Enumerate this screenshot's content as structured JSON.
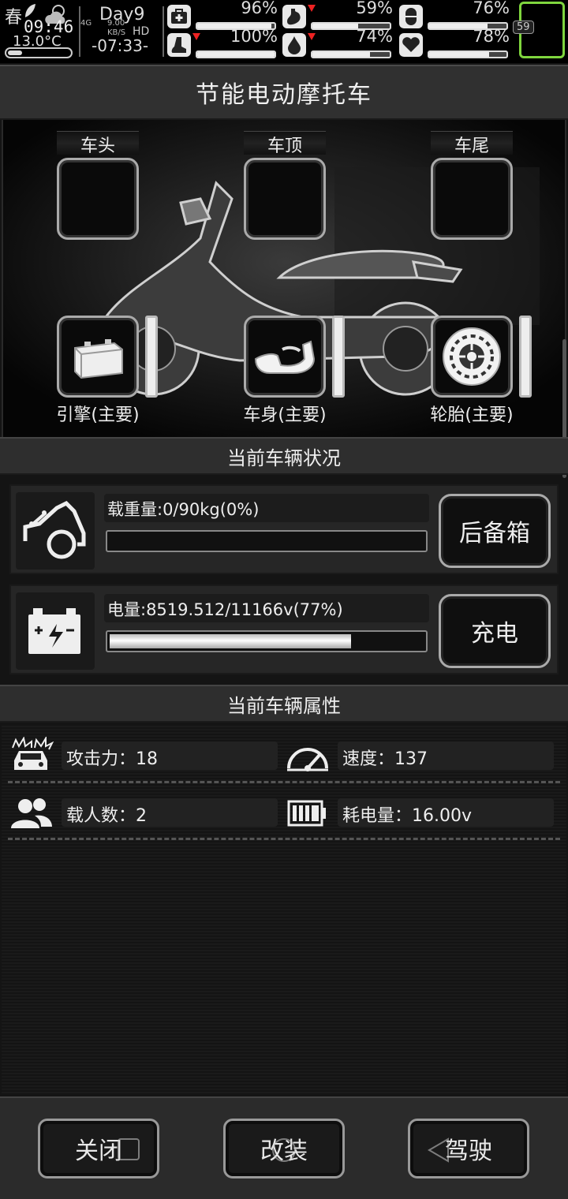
{
  "status_bar": {
    "season": "春",
    "time": "09:46",
    "temperature": "13.0°C",
    "day": "Day9",
    "network": "4G",
    "net_speed_value": "9.00",
    "net_speed_unit": "KB/S",
    "hd": "HD",
    "clock": "-07:33-",
    "stats": [
      {
        "icon": "medkit-icon",
        "value": "96%",
        "level": 0.96,
        "down": false
      },
      {
        "icon": "stomach-icon",
        "value": "59%",
        "level": 0.59,
        "down": true
      },
      {
        "icon": "capsule-icon",
        "value": "76%",
        "level": 0.76,
        "down": false
      },
      {
        "icon": "foot-icon",
        "value": "100%",
        "level": 1.0,
        "down": true
      },
      {
        "icon": "water-drop-icon",
        "value": "74%",
        "level": 0.74,
        "down": true
      },
      {
        "icon": "heart-icon",
        "value": "78%",
        "level": 0.78,
        "down": false
      }
    ],
    "battery_number": "59",
    "battery_color": "#7fd63e"
  },
  "title": "节能电动摩托车",
  "slots_top": [
    {
      "label": "车头"
    },
    {
      "label": "车顶"
    },
    {
      "label": "车尾"
    }
  ],
  "parts": [
    {
      "label": "引擎(主要)",
      "icon": "battery-engine-icon"
    },
    {
      "label": "车身(主要)",
      "icon": "scooter-body-icon"
    },
    {
      "label": "轮胎(主要)",
      "icon": "tire-icon"
    }
  ],
  "condition": {
    "header": "当前车辆状况",
    "cargo_text": "载重量:0/90kg(0%)",
    "cargo_level": 0,
    "cargo_button": "后备箱",
    "power_text": "电量:8519.512/11166v(77%)",
    "power_level": 0.77,
    "power_button": "充电"
  },
  "attributes": {
    "header": "当前车辆属性",
    "items": [
      {
        "label": "攻击力：18",
        "icon": "car-crash-icon"
      },
      {
        "label": "速度：137",
        "icon": "speedometer-icon"
      },
      {
        "label": "载人数：2",
        "icon": "people-icon"
      },
      {
        "label": "耗电量：16.00v",
        "icon": "battery-level-icon"
      }
    ]
  },
  "buttons": {
    "close": "关闭",
    "modify": "改装",
    "drive": "驾驶"
  }
}
